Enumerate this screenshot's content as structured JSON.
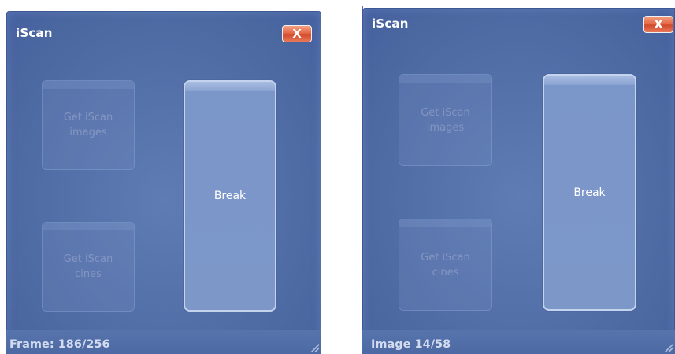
{
  "dialogs": [
    {
      "title": "iScan",
      "close_label": "X",
      "images_button": "Get iScan\nimages",
      "cines_button": "Get iScan\ncines",
      "break_button": "Break",
      "status": "Frame: 186/256"
    },
    {
      "title": "iScan",
      "close_label": "X",
      "images_button": "Get iScan\nimages",
      "cines_button": "Get iScan\ncines",
      "break_button": "Break",
      "status": "Image 14/58"
    }
  ],
  "colors": {
    "dialog_bg": "#5470a9",
    "close_red": "#e2603f",
    "break_btn": "#7d97c9",
    "disabled_text": "#8396c2"
  },
  "icons": {
    "close": "close-icon",
    "grip": "resize-grip-icon"
  }
}
